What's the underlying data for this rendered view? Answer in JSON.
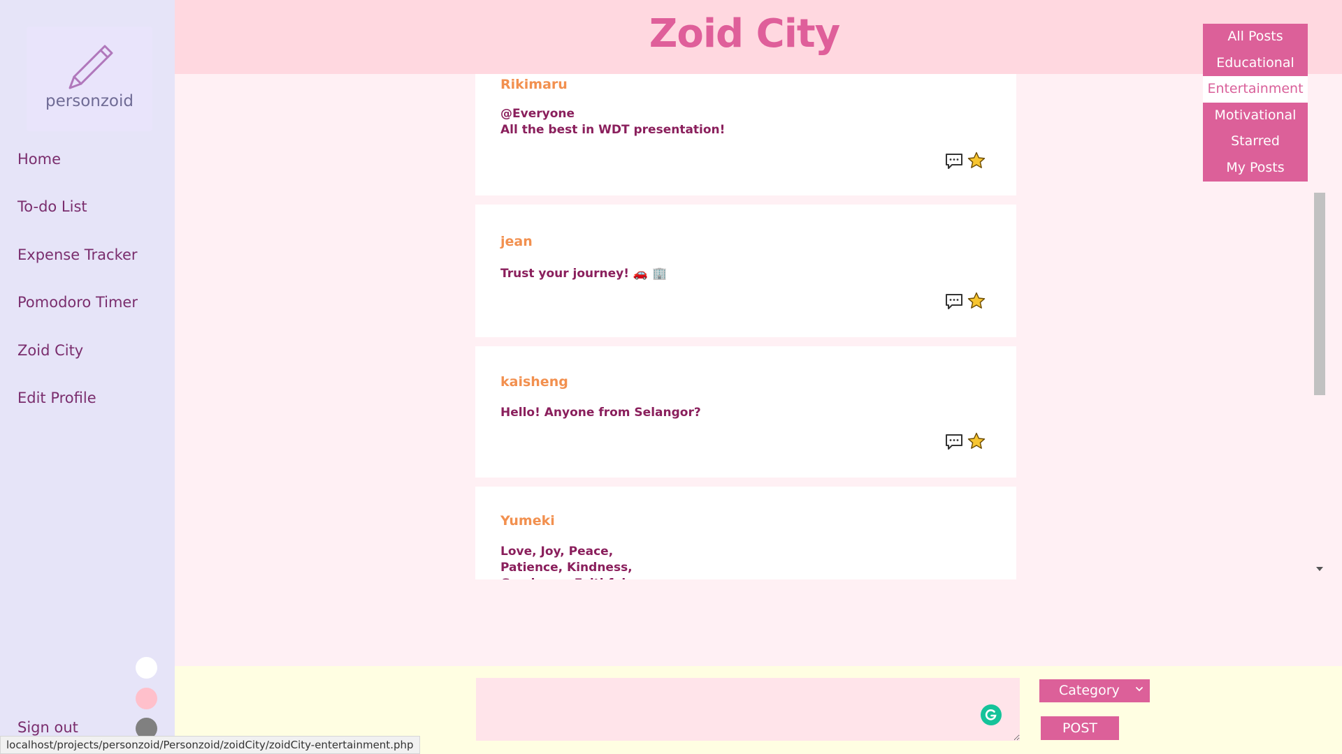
{
  "sidebar": {
    "logo_text": "personzoid",
    "nav": [
      {
        "label": "Home"
      },
      {
        "label": "To-do List"
      },
      {
        "label": "Expense Tracker"
      },
      {
        "label": "Pomodoro Timer"
      },
      {
        "label": "Zoid City"
      },
      {
        "label": "Edit Profile"
      }
    ],
    "theme_colors": [
      "#ffffff",
      "#ffc0cb",
      "#808080"
    ],
    "signout_label": "Sign out"
  },
  "header": {
    "title": "Zoid City"
  },
  "categories": {
    "items": [
      "All Posts",
      "Educational",
      "Entertainment",
      "Motivational",
      "Starred",
      "My Posts"
    ],
    "active": "Entertainment"
  },
  "posts": [
    {
      "user": "Rikimaru",
      "body": "@Everyone\nAll the best in WDT presentation!"
    },
    {
      "user": "jean",
      "body": "Trust your journey! 🚗 🏢"
    },
    {
      "user": "kaisheng",
      "body": "Hello! Anyone from Selangor?"
    },
    {
      "user": "Yumeki",
      "body": "Love, Joy, Peace,\nPatience, Kindness,\nGoodness, Faithful"
    }
  ],
  "composer": {
    "category_label": "Category",
    "post_label": "POST"
  },
  "status_bar": {
    "url": "localhost/projects/personzoid/Personzoid/zoidCity/zoidCity-entertainment.php"
  },
  "colors": {
    "accent": "#dc6099",
    "username": "#f2904f",
    "post_text": "#8a1f5c",
    "header_bg": "#ffd8e0",
    "sidebar_bg": "#e6e4f8"
  }
}
